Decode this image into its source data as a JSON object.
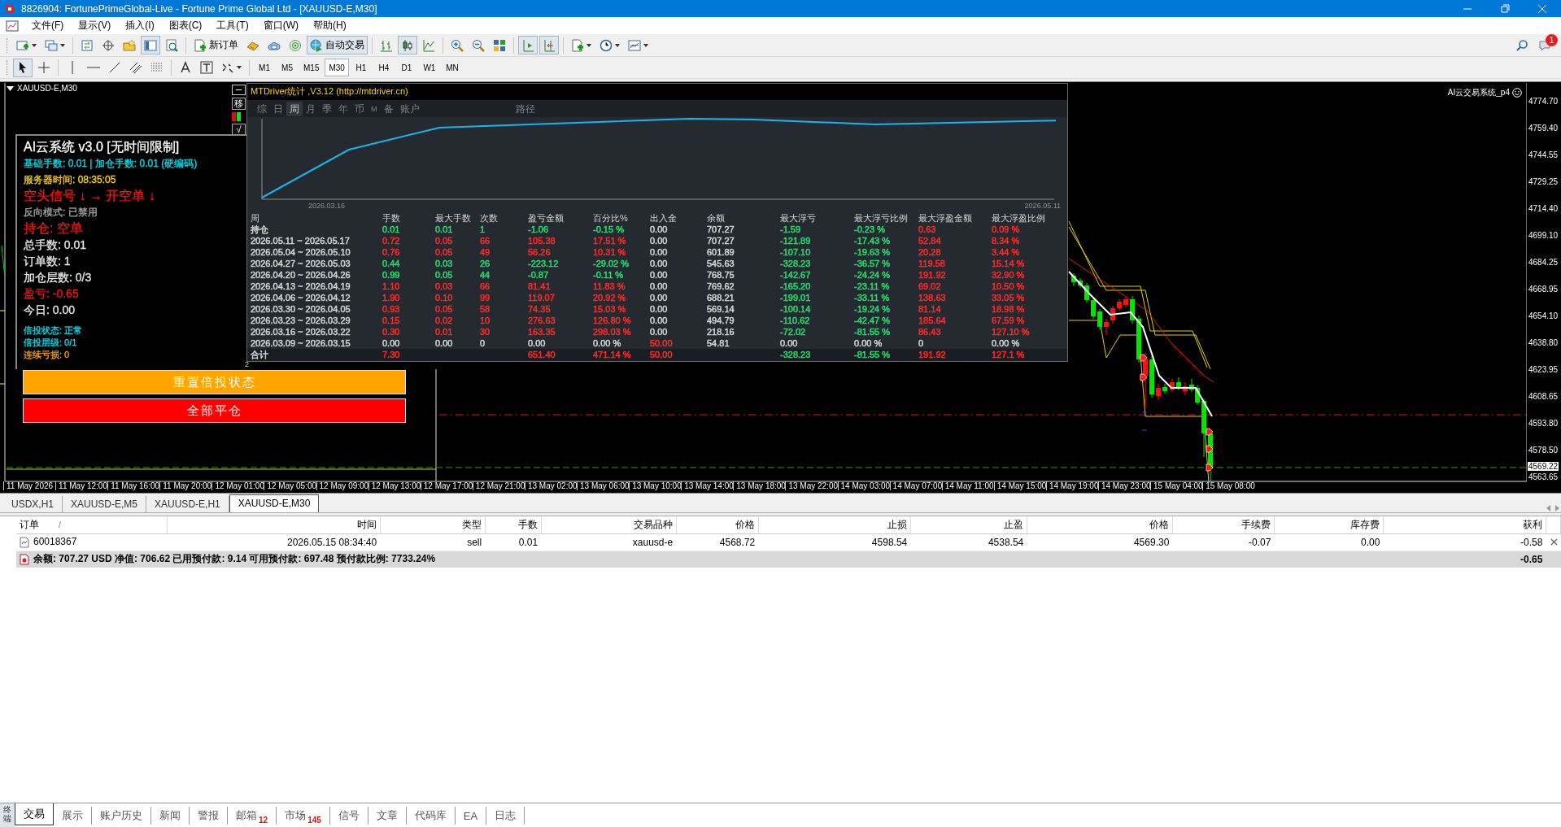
{
  "window": {
    "title": "8826904: FortunePrimeGlobal-Live - Fortune Prime Global Ltd - [XAUUSD-E,M30]"
  },
  "menu": [
    "文件(F)",
    "显示(V)",
    "插入(I)",
    "图表(C)",
    "工具(T)",
    "窗口(W)",
    "帮助(H)"
  ],
  "toolbar": {
    "buttons": [
      {
        "kind": "icon",
        "pressed": false
      },
      {
        "kind": "icon",
        "pressed": false
      },
      {
        "kind": "icon",
        "pressed": false
      },
      {
        "kind": "icon",
        "pressed": false
      },
      {
        "kind": "icon",
        "pressed": false
      },
      {
        "kind": "icon",
        "pressed": true
      },
      {
        "kind": "icon",
        "pressed": false
      },
      {
        "kind": "text",
        "label": "新订单",
        "pressed": false
      },
      {
        "kind": "icon",
        "pressed": false
      },
      {
        "kind": "icon",
        "pressed": false
      },
      {
        "kind": "icon",
        "pressed": false
      },
      {
        "kind": "text",
        "label": "自动交易",
        "pressed": true
      },
      {
        "kind": "icon",
        "pressed": false
      },
      {
        "kind": "icon",
        "pressed": true
      },
      {
        "kind": "icon",
        "pressed": false
      },
      {
        "kind": "icon",
        "pressed": false
      },
      {
        "kind": "icon",
        "pressed": false
      },
      {
        "kind": "icon",
        "pressed": false
      },
      {
        "kind": "icon",
        "pressed": true
      },
      {
        "kind": "icon",
        "pressed": true
      },
      {
        "kind": "icon",
        "pressed": false
      },
      {
        "kind": "icon",
        "pressed": false
      },
      {
        "kind": "icon",
        "pressed": false
      }
    ],
    "notification_count": "1"
  },
  "drawing_tools": [
    {
      "pressed": true
    },
    {
      "pressed": false
    },
    {
      "pressed": false
    },
    {
      "pressed": false
    },
    {
      "pressed": false
    },
    {
      "pressed": false
    },
    {
      "pressed": false
    },
    {
      "pressed": false
    },
    {
      "pressed": false
    },
    {
      "pressed": false
    }
  ],
  "timeframes": [
    {
      "label": "M1",
      "selected": false
    },
    {
      "label": "M5",
      "selected": false
    },
    {
      "label": "M15",
      "selected": false
    },
    {
      "label": "M30",
      "selected": true
    },
    {
      "label": "H1",
      "selected": false
    },
    {
      "label": "H4",
      "selected": false
    },
    {
      "label": "D1",
      "selected": false
    },
    {
      "label": "W1",
      "selected": false
    },
    {
      "label": "MN",
      "selected": false
    }
  ],
  "chart": {
    "symbol": "XAUUSD-E,M30",
    "indicator": "AI云交易系统_p4",
    "move_button": "移",
    "check_button": "√",
    "marker": "2",
    "price_axis": [
      "4774.70",
      "4759.40",
      "4744.55",
      "4729.25",
      "4714.40",
      "4699.10",
      "4684.25",
      "4668.95",
      "4654.10",
      "4638.80",
      "4623.95",
      "4608.65",
      "4593.80",
      "4578.50"
    ],
    "current_price": "4569.22",
    "bottom_price": "4563.65",
    "time_axis": [
      "11 May 2026",
      "11 May 12:00",
      "11 May 16:00",
      "11 May 20:00",
      "12 May 01:00",
      "12 May 05:00",
      "12 May 09:00",
      "12 May 13:00",
      "12 May 17:00",
      "12 May 21:00",
      "13 May 02:00",
      "13 May 06:00",
      "13 May 10:00",
      "13 May 14:00",
      "13 May 18:00",
      "13 May 22:00",
      "14 May 03:00",
      "14 May 07:00",
      "14 May 11:00",
      "14 May 15:00",
      "14 May 19:00",
      "14 May 23:00",
      "15 May 04:00",
      "15 May 08:00"
    ]
  },
  "ea_panel": {
    "title": "AI云系统 v3.0 [无时间限制]",
    "lines": [
      {
        "text": "基础手数: 0.01 | 加仓手数: 0.01 (硬编码)",
        "color": "#00e0f0",
        "kind": "small"
      },
      {
        "text": "服务器时间: 08:35:05",
        "color": "#ffd700",
        "kind": "small"
      },
      {
        "text": "空头信号 ↓ → 开空单 ↓",
        "color": "#ff1010",
        "kind": "large"
      },
      {
        "text": "反向模式: 已禁用",
        "color": "#a8a8a8",
        "kind": "small"
      },
      {
        "text": "持仓: 空单",
        "color": "#ff1010",
        "kind": "large"
      },
      {
        "text": "总手数: 0.01",
        "color": "#e8e8e8",
        "kind": "medium"
      },
      {
        "text": "订单数: 1",
        "color": "#e8e8e8",
        "kind": "medium"
      },
      {
        "text": "加仓层数: 0/3",
        "color": "#e8e8e8",
        "kind": "medium"
      },
      {
        "text": "盈亏: -0.65",
        "color": "#ff1010",
        "kind": "medium"
      },
      {
        "text": "今日: 0.00",
        "color": "#e8e8e8",
        "kind": "medium"
      }
    ],
    "status_lines": [
      {
        "text": "倍投状态: 正常",
        "color": "#00e0f0"
      },
      {
        "text": "倍投层级: 0/1",
        "color": "#00e0f0"
      },
      {
        "text": "连续亏损: 0",
        "color": "#ffa500"
      }
    ],
    "buttons": [
      {
        "label": "重置倍投状态",
        "color": "#ffa500"
      },
      {
        "label": "全部平仓",
        "color": "#ff0000"
      }
    ]
  },
  "stats": {
    "title": "MTDriver统计 ,V3.12 (http://mtdriver.cn)",
    "tabs": [
      {
        "label": "综",
        "selected": false
      },
      {
        "label": "日",
        "selected": false
      },
      {
        "label": "周",
        "selected": true
      },
      {
        "label": "月",
        "selected": false
      },
      {
        "label": "季",
        "selected": false
      },
      {
        "label": "年",
        "selected": false
      },
      {
        "label": "币",
        "selected": false
      },
      {
        "label": "M",
        "selected": false
      },
      {
        "label": "备",
        "selected": false
      },
      {
        "label": "账户",
        "selected": false
      }
    ],
    "path_label": "路径",
    "chart_labels": [
      "2026.03.16",
      "2026.05.11"
    ],
    "columns": [
      "周",
      "手数",
      "最大手数",
      "次数",
      "盈亏金额",
      "百分比%",
      "出入金",
      "余额",
      "最大浮亏",
      "最大浮亏比例",
      "最大浮盈金额",
      "最大浮盈比例"
    ],
    "rows": [
      {
        "cells": [
          {
            "text": "持仓",
            "color": "#d4d4d4"
          },
          {
            "text": "0.01",
            "color": "#1fe070"
          },
          {
            "text": "0.01",
            "color": "#1fe070"
          },
          {
            "text": "1",
            "color": "#1fe070"
          },
          {
            "text": "-1.06",
            "color": "#1fe070"
          },
          {
            "text": "-0.15 %",
            "color": "#1fe070"
          },
          {
            "text": "0.00",
            "color": "#d4d4d4"
          },
          {
            "text": "707.27",
            "color": "#d4d4d4"
          },
          {
            "text": "-1.59",
            "color": "#1fe070"
          },
          {
            "text": "-0.23 %",
            "color": "#1fe070"
          },
          {
            "text": "0.63",
            "color": "#ff2a2a"
          },
          {
            "text": "0.09 %",
            "color": "#ff2a2a"
          }
        ]
      },
      {
        "cells": [
          {
            "text": "2026.05.11 ~ 2026.05.17",
            "color": "#d4d4d4"
          },
          {
            "text": "0.72",
            "color": "#ff2a2a"
          },
          {
            "text": "0.05",
            "color": "#ff2a2a"
          },
          {
            "text": "66",
            "color": "#ff2a2a"
          },
          {
            "text": "105.38",
            "color": "#ff2a2a"
          },
          {
            "text": "17.51 %",
            "color": "#ff2a2a"
          },
          {
            "text": "0.00",
            "color": "#d4d4d4"
          },
          {
            "text": "707.27",
            "color": "#d4d4d4"
          },
          {
            "text": "-121.89",
            "color": "#1fe070"
          },
          {
            "text": "-17.43 %",
            "color": "#1fe070"
          },
          {
            "text": "52.84",
            "color": "#ff2a2a"
          },
          {
            "text": "8.34 %",
            "color": "#ff2a2a"
          }
        ]
      },
      {
        "cells": [
          {
            "text": "2026.05.04 ~ 2026.05.10",
            "color": "#d4d4d4"
          },
          {
            "text": "0.76",
            "color": "#ff2a2a"
          },
          {
            "text": "0.05",
            "color": "#ff2a2a"
          },
          {
            "text": "49",
            "color": "#ff2a2a"
          },
          {
            "text": "56.26",
            "color": "#ff2a2a"
          },
          {
            "text": "10.31 %",
            "color": "#ff2a2a"
          },
          {
            "text": "0.00",
            "color": "#d4d4d4"
          },
          {
            "text": "601.89",
            "color": "#d4d4d4"
          },
          {
            "text": "-107.10",
            "color": "#1fe070"
          },
          {
            "text": "-19.63 %",
            "color": "#1fe070"
          },
          {
            "text": "20.28",
            "color": "#ff2a2a"
          },
          {
            "text": "3.44 %",
            "color": "#ff2a2a"
          }
        ]
      },
      {
        "cells": [
          {
            "text": "2026.04.27 ~ 2026.05.03",
            "color": "#d4d4d4"
          },
          {
            "text": "0.44",
            "color": "#1fe070"
          },
          {
            "text": "0.03",
            "color": "#1fe070"
          },
          {
            "text": "26",
            "color": "#1fe070"
          },
          {
            "text": "-223.12",
            "color": "#1fe070"
          },
          {
            "text": "-29.02 %",
            "color": "#1fe070"
          },
          {
            "text": "0.00",
            "color": "#d4d4d4"
          },
          {
            "text": "545.63",
            "color": "#d4d4d4"
          },
          {
            "text": "-328.23",
            "color": "#1fe070"
          },
          {
            "text": "-36.57 %",
            "color": "#1fe070"
          },
          {
            "text": "119.58",
            "color": "#ff2a2a"
          },
          {
            "text": "15.14 %",
            "color": "#ff2a2a"
          }
        ]
      },
      {
        "cells": [
          {
            "text": "2026.04.20 ~ 2026.04.26",
            "color": "#d4d4d4"
          },
          {
            "text": "0.99",
            "color": "#1fe070"
          },
          {
            "text": "0.05",
            "color": "#1fe070"
          },
          {
            "text": "44",
            "color": "#1fe070"
          },
          {
            "text": "-0.87",
            "color": "#1fe070"
          },
          {
            "text": "-0.11 %",
            "color": "#1fe070"
          },
          {
            "text": "0.00",
            "color": "#d4d4d4"
          },
          {
            "text": "768.75",
            "color": "#d4d4d4"
          },
          {
            "text": "-142.67",
            "color": "#1fe070"
          },
          {
            "text": "-24.24 %",
            "color": "#1fe070"
          },
          {
            "text": "191.92",
            "color": "#ff2a2a"
          },
          {
            "text": "32.90 %",
            "color": "#ff2a2a"
          }
        ]
      },
      {
        "cells": [
          {
            "text": "2026.04.13 ~ 2026.04.19",
            "color": "#d4d4d4"
          },
          {
            "text": "1.10",
            "color": "#ff2a2a"
          },
          {
            "text": "0.03",
            "color": "#ff2a2a"
          },
          {
            "text": "66",
            "color": "#ff2a2a"
          },
          {
            "text": "81.41",
            "color": "#ff2a2a"
          },
          {
            "text": "11.83 %",
            "color": "#ff2a2a"
          },
          {
            "text": "0.00",
            "color": "#d4d4d4"
          },
          {
            "text": "769.62",
            "color": "#d4d4d4"
          },
          {
            "text": "-165.20",
            "color": "#1fe070"
          },
          {
            "text": "-23.11 %",
            "color": "#1fe070"
          },
          {
            "text": "69.02",
            "color": "#ff2a2a"
          },
          {
            "text": "10.50 %",
            "color": "#ff2a2a"
          }
        ]
      },
      {
        "cells": [
          {
            "text": "2026.04.06 ~ 2026.04.12",
            "color": "#d4d4d4"
          },
          {
            "text": "1.90",
            "color": "#ff2a2a"
          },
          {
            "text": "0.10",
            "color": "#ff2a2a"
          },
          {
            "text": "99",
            "color": "#ff2a2a"
          },
          {
            "text": "119.07",
            "color": "#ff2a2a"
          },
          {
            "text": "20.92 %",
            "color": "#ff2a2a"
          },
          {
            "text": "0.00",
            "color": "#d4d4d4"
          },
          {
            "text": "688.21",
            "color": "#d4d4d4"
          },
          {
            "text": "-199.01",
            "color": "#1fe070"
          },
          {
            "text": "-33.11 %",
            "color": "#1fe070"
          },
          {
            "text": "138.63",
            "color": "#ff2a2a"
          },
          {
            "text": "33.05 %",
            "color": "#ff2a2a"
          }
        ]
      },
      {
        "cells": [
          {
            "text": "2026.03.30 ~ 2026.04.05",
            "color": "#d4d4d4"
          },
          {
            "text": "0.93",
            "color": "#ff2a2a"
          },
          {
            "text": "0.05",
            "color": "#ff2a2a"
          },
          {
            "text": "58",
            "color": "#ff2a2a"
          },
          {
            "text": "74.35",
            "color": "#ff2a2a"
          },
          {
            "text": "15.03 %",
            "color": "#ff2a2a"
          },
          {
            "text": "0.00",
            "color": "#d4d4d4"
          },
          {
            "text": "569.14",
            "color": "#d4d4d4"
          },
          {
            "text": "-100.14",
            "color": "#1fe070"
          },
          {
            "text": "-19.24 %",
            "color": "#1fe070"
          },
          {
            "text": "81.14",
            "color": "#ff2a2a"
          },
          {
            "text": "18.98 %",
            "color": "#ff2a2a"
          }
        ]
      },
      {
        "cells": [
          {
            "text": "2026.03.23 ~ 2026.03.29",
            "color": "#d4d4d4"
          },
          {
            "text": "0.15",
            "color": "#ff2a2a"
          },
          {
            "text": "0.02",
            "color": "#ff2a2a"
          },
          {
            "text": "10",
            "color": "#ff2a2a"
          },
          {
            "text": "276.63",
            "color": "#ff2a2a"
          },
          {
            "text": "126.80 %",
            "color": "#ff2a2a"
          },
          {
            "text": "0.00",
            "color": "#d4d4d4"
          },
          {
            "text": "494.79",
            "color": "#d4d4d4"
          },
          {
            "text": "-110.62",
            "color": "#1fe070"
          },
          {
            "text": "-42.47 %",
            "color": "#1fe070"
          },
          {
            "text": "185.64",
            "color": "#ff2a2a"
          },
          {
            "text": "67.59 %",
            "color": "#ff2a2a"
          }
        ]
      },
      {
        "cells": [
          {
            "text": "2026.03.16 ~ 2026.03.22",
            "color": "#d4d4d4"
          },
          {
            "text": "0.30",
            "color": "#ff2a2a"
          },
          {
            "text": "0.01",
            "color": "#ff2a2a"
          },
          {
            "text": "30",
            "color": "#ff2a2a"
          },
          {
            "text": "163.35",
            "color": "#ff2a2a"
          },
          {
            "text": "298.03 %",
            "color": "#ff2a2a"
          },
          {
            "text": "0.00",
            "color": "#d4d4d4"
          },
          {
            "text": "218.16",
            "color": "#d4d4d4"
          },
          {
            "text": "-72.02",
            "color": "#1fe070"
          },
          {
            "text": "-81.55 %",
            "color": "#1fe070"
          },
          {
            "text": "86.43",
            "color": "#ff2a2a"
          },
          {
            "text": "127.10 %",
            "color": "#ff2a2a"
          }
        ]
      },
      {
        "cells": [
          {
            "text": "2026.03.09 ~ 2026.03.15",
            "color": "#d4d4d4"
          },
          {
            "text": "0.00",
            "color": "#d4d4d4"
          },
          {
            "text": "0.00",
            "color": "#d4d4d4"
          },
          {
            "text": "0",
            "color": "#d4d4d4"
          },
          {
            "text": "0.00",
            "color": "#d4d4d4"
          },
          {
            "text": "0.00 %",
            "color": "#d4d4d4"
          },
          {
            "text": "50.00",
            "color": "#ff2a2a"
          },
          {
            "text": "54.81",
            "color": "#d4d4d4"
          },
          {
            "text": "0.00",
            "color": "#d4d4d4"
          },
          {
            "text": "0.00 %",
            "color": "#d4d4d4"
          },
          {
            "text": "0",
            "color": "#d4d4d4"
          },
          {
            "text": "0.00 %",
            "color": "#d4d4d4"
          }
        ]
      }
    ],
    "total": {
      "cells": [
        {
          "text": "合计",
          "color": "#d4d4d4"
        },
        {
          "text": "7.30",
          "color": "#ff2a2a"
        },
        null,
        null,
        {
          "text": "651.40",
          "color": "#ff2a2a"
        },
        {
          "text": "471.14 %",
          "color": "#ff2a2a"
        },
        {
          "text": "50.00",
          "color": "#ff2a2a"
        },
        null,
        {
          "text": "-328.23",
          "color": "#1fe070"
        },
        {
          "text": "-81.55 %",
          "color": "#1fe070"
        },
        {
          "text": "191.92",
          "color": "#ff2a2a"
        },
        {
          "text": "127.1 %",
          "color": "#ff2a2a"
        }
      ]
    }
  },
  "chart_tabs": [
    {
      "label": "USDX,H1",
      "selected": false
    },
    {
      "label": "XAUUSD-E,M5",
      "selected": false
    },
    {
      "label": "XAUUSD-E,H1",
      "selected": false
    },
    {
      "label": "XAUUSD-E,M30",
      "selected": true
    }
  ],
  "orders": {
    "columns": [
      "订单",
      "时间",
      "类型",
      "手数",
      "交易品种",
      "价格",
      "止损",
      "止盈",
      "价格",
      "手续费",
      "库存费",
      "获利"
    ],
    "sort_mark": "/",
    "rows": [
      {
        "cells": [
          "60018367",
          "2026.05.15 08:34:40",
          "sell",
          "0.01",
          "xauusd-e",
          "4568.72",
          "4598.54",
          "4538.54",
          "4569.30",
          "-0.07",
          "0.00",
          "-0.58"
        ]
      }
    ],
    "summary": "余额: 707.27 USD  净值: 706.62  已用预付款: 9.14  可用预付款: 697.48  预付款比例: 7733.24%",
    "summary_profit": "-0.65"
  },
  "terminal_label": "终端",
  "bottom_tabs": [
    {
      "label": "交易",
      "selected": true
    },
    {
      "label": "展示",
      "selected": false
    },
    {
      "label": "账户历史",
      "selected": false
    },
    {
      "label": "新闻",
      "selected": false
    },
    {
      "label": "警报",
      "selected": false
    },
    {
      "label": "邮箱",
      "selected": false,
      "badge": "12"
    },
    {
      "label": "市场",
      "selected": false,
      "badge": "145"
    },
    {
      "label": "信号",
      "selected": false
    },
    {
      "label": "文章",
      "selected": false
    },
    {
      "label": "代码库",
      "selected": false
    },
    {
      "label": "EA",
      "selected": false
    },
    {
      "label": "日志",
      "selected": false
    }
  ]
}
